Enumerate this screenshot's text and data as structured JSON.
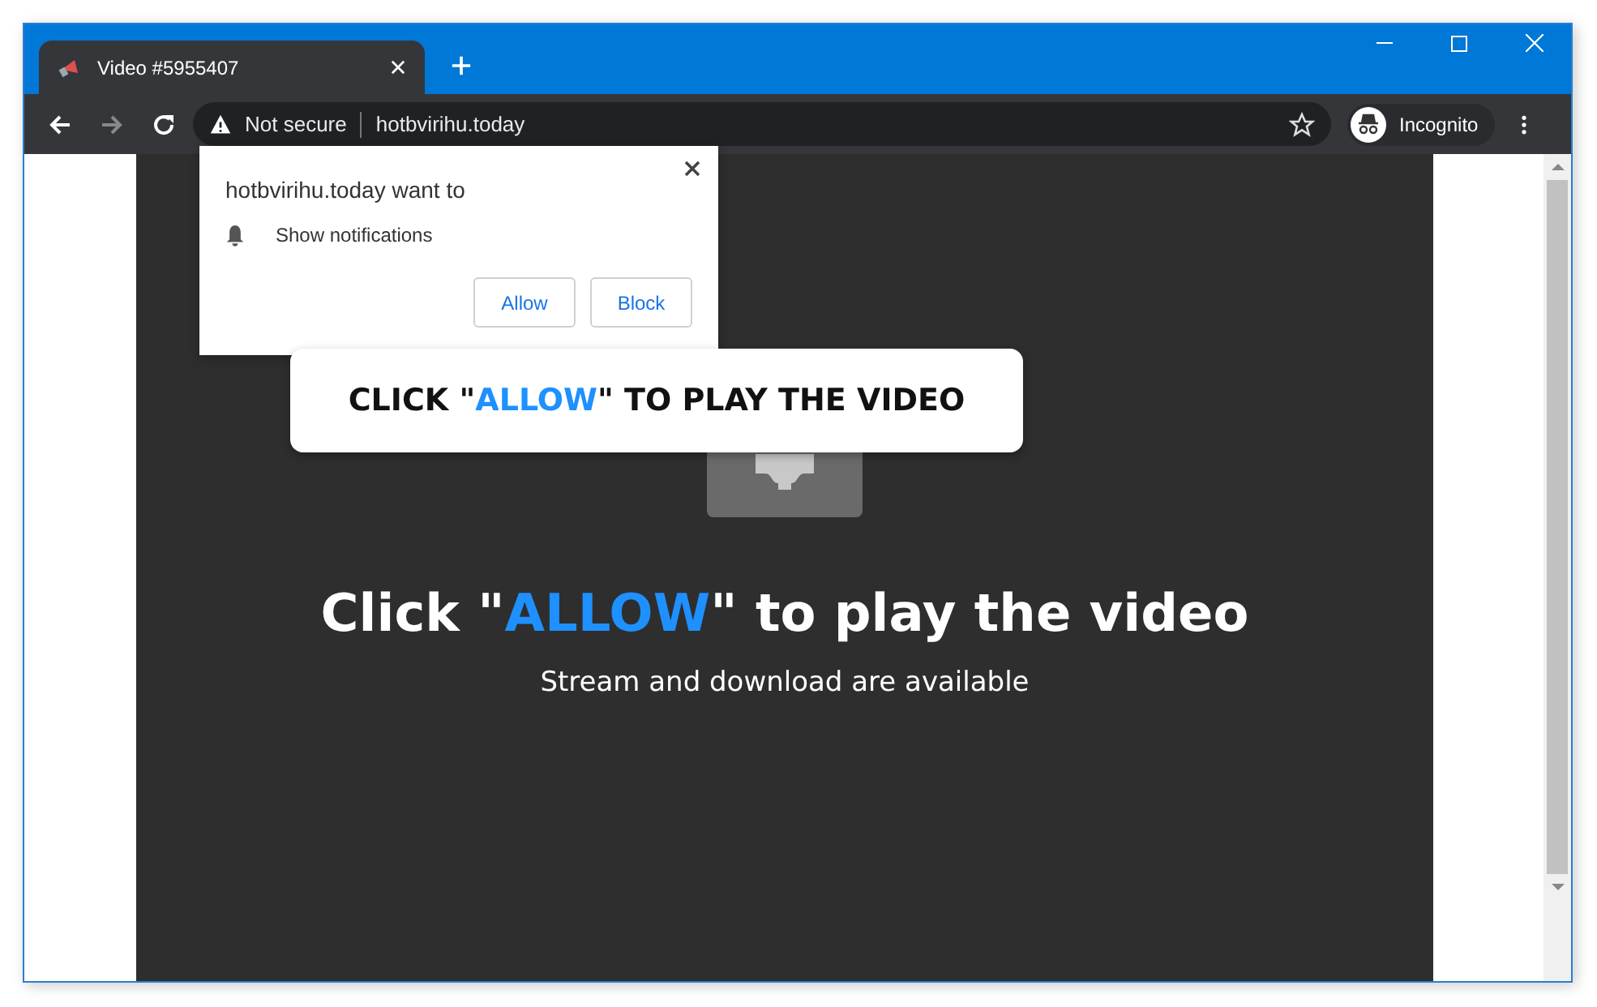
{
  "tabs": [
    {
      "title": "Video #5955407",
      "selected": true
    }
  ],
  "toolbar": {
    "security_label": "Not secure",
    "url": "hotbvirihu.today",
    "profile_label": "Incognito"
  },
  "permission_prompt": {
    "title": "hotbvirihu.today want to",
    "permission": "Show notifications",
    "buttons": [
      "Allow",
      "Block"
    ]
  },
  "banner": {
    "before": "CLICK \"",
    "highlight": "ALLOW",
    "after": "\" TO PLAY THE VIDEO"
  },
  "page": {
    "headline": {
      "before": "Click \"",
      "highlight": "ALLOW",
      "after": "\" to play the video"
    },
    "subtitle": "Stream and download are available"
  }
}
